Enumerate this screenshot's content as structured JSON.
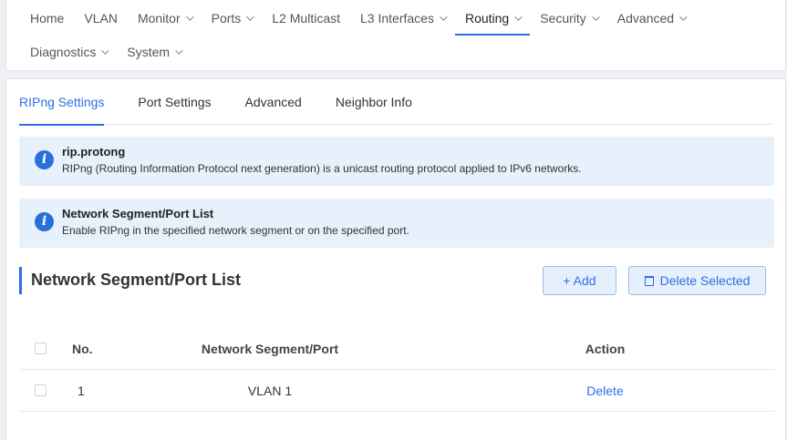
{
  "nav": {
    "row1": [
      {
        "label": "Home",
        "has_menu": false
      },
      {
        "label": "VLAN",
        "has_menu": false
      },
      {
        "label": "Monitor",
        "has_menu": true
      },
      {
        "label": "Ports",
        "has_menu": true
      },
      {
        "label": "L2 Multicast",
        "has_menu": false
      },
      {
        "label": "L3 Interfaces",
        "has_menu": true
      },
      {
        "label": "Routing",
        "has_menu": true,
        "active": true
      },
      {
        "label": "Security",
        "has_menu": true
      },
      {
        "label": "Advanced",
        "has_menu": true
      }
    ],
    "row2": [
      {
        "label": "Diagnostics",
        "has_menu": true
      },
      {
        "label": "System",
        "has_menu": true
      }
    ]
  },
  "tabs": [
    {
      "label": "RIPng Settings",
      "active": true
    },
    {
      "label": "Port Settings"
    },
    {
      "label": "Advanced"
    },
    {
      "label": "Neighbor Info"
    }
  ],
  "alerts": [
    {
      "icon": "info-icon",
      "title": "rip.protong",
      "text": "RIPng (Routing Information Protocol next generation) is a unicast routing protocol applied to IPv6 networks."
    },
    {
      "icon": "info-icon",
      "title": "Network Segment/Port List",
      "text": "Enable RIPng in the specified network segment or on the specified port."
    }
  ],
  "section": {
    "title": "Network Segment/Port List",
    "add_label": "+ Add",
    "delete_selected_label": "Delete Selected"
  },
  "table": {
    "columns": [
      "No.",
      "Network Segment/Port",
      "Action"
    ],
    "rows": [
      {
        "no": "1",
        "segment": "VLAN 1",
        "action": "Delete"
      }
    ]
  },
  "colors": {
    "accent": "#2d6ee6",
    "alert_bg": "#e6f1fc",
    "page_bg": "#eef0f3"
  }
}
